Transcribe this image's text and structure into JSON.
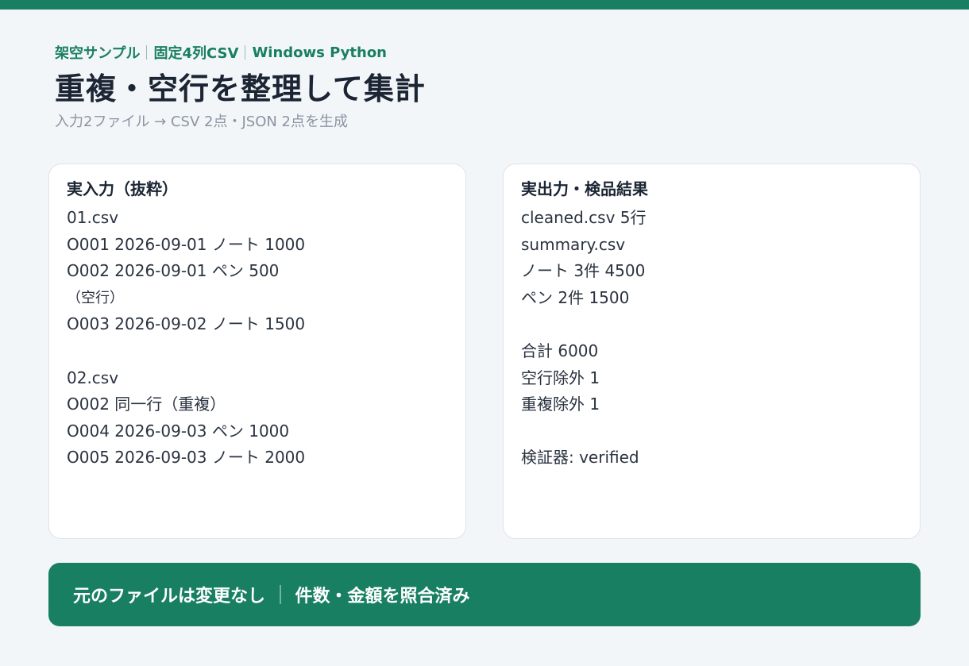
{
  "header": {
    "tags": [
      "架空サンプル",
      "固定4列CSV",
      "Windows Python"
    ],
    "title": "重複・空行を整理して集計",
    "subtitle": "入力2ファイル → CSV 2点・JSON 2点を生成"
  },
  "input_card": {
    "title": "実入力（抜粋）",
    "lines": [
      "01.csv",
      "O001 2026-09-01 ノート 1000",
      "O002 2026-09-01 ペン 500",
      "（空行）",
      "O003 2026-09-02 ノート 1500",
      "",
      "02.csv",
      "O002 同一行（重複）",
      "O004 2026-09-03 ペン 1000",
      "O005 2026-09-03 ノート 2000"
    ]
  },
  "output_card": {
    "title": "実出力・検品結果",
    "lines": [
      "cleaned.csv 5行",
      "summary.csv",
      "ノート 3件 4500",
      "ペン 2件 1500",
      "",
      "合計 6000",
      "空行除外 1",
      "重複除外 1",
      "",
      "検証器: verified"
    ]
  },
  "banner": {
    "left": "元のファイルは変更なし",
    "right": "件数・金額を照合済み"
  },
  "colors": {
    "accent": "#187f63",
    "background": "#f3f6f9",
    "card": "#ffffff"
  }
}
